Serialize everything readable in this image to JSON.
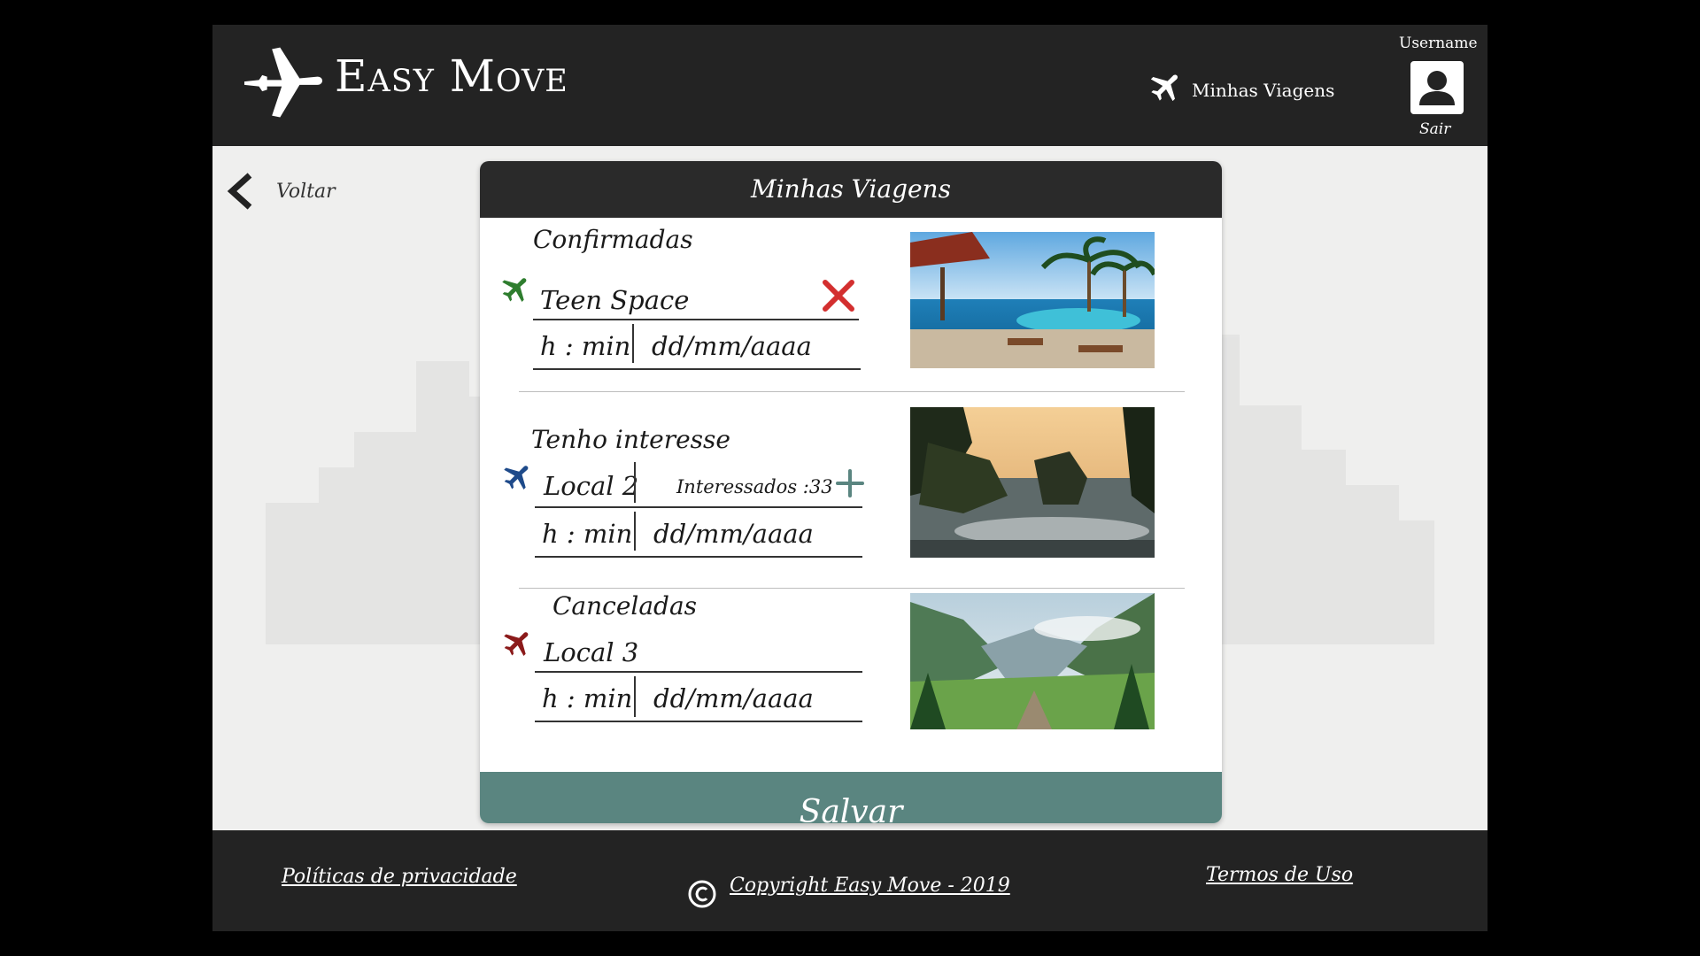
{
  "header": {
    "brand": "Easy Move",
    "nav_trips_label": "Minhas Viagens",
    "username": "Username",
    "logout_label": "Sair"
  },
  "back": {
    "label": "Voltar"
  },
  "card": {
    "title": "Minhas Viagens",
    "sections": [
      {
        "title": "Confirmadas",
        "status_color": "#2e7d2e",
        "trip_name": "Teen Space",
        "time_placeholder": "h : min",
        "date_placeholder": "dd/mm/aaaa",
        "action_icon": "close-icon",
        "action_color": "#d32f2f"
      },
      {
        "title": "Tenho interesse",
        "status_color": "#1e4a8a",
        "trip_name": "Local 2",
        "interested_label": "Interessados :33",
        "time_placeholder": "h : min",
        "date_placeholder": "dd/mm/aaaa",
        "action_icon": "plus-icon",
        "action_color": "#5a8580"
      },
      {
        "title": "Canceladas",
        "status_color": "#8b1a1a",
        "trip_name": "Local 3",
        "time_placeholder": "h : min",
        "date_placeholder": "dd/mm/aaaa"
      }
    ],
    "save_label": "Salvar"
  },
  "footer": {
    "privacy_label": "Políticas de privacidade",
    "copyright_label": "Copyright Easy Move - 2019",
    "terms_label": "Termos de Uso"
  },
  "colors": {
    "header_bg": "#232323",
    "page_bg": "#efefee",
    "accent": "#5a8580"
  }
}
